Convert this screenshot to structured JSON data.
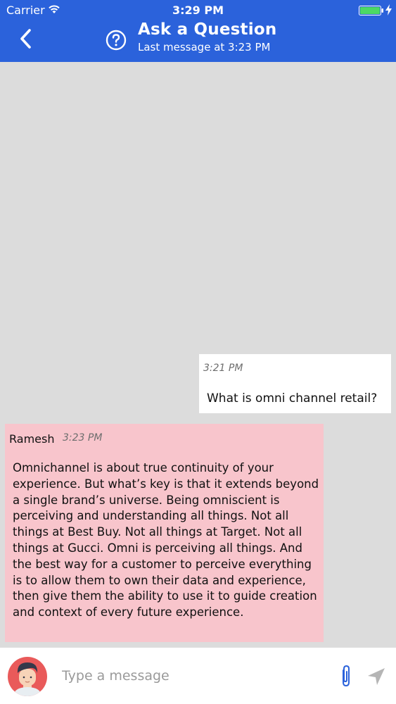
{
  "status_bar": {
    "carrier": "Carrier",
    "time": "3:29 PM"
  },
  "header": {
    "title": "Ask a Question",
    "subtitle": "Last message at 3:23 PM"
  },
  "messages": [
    {
      "time": "3:21 PM",
      "text": "What is omni channel retail?"
    },
    {
      "sender": "Ramesh",
      "time": "3:23 PM",
      "text": "Omnichannel is about true continuity of your experience. But what’s key is that it extends beyond a single brand’s universe. Being omniscient is perceiving and understanding all things.  Not all things at Best Buy. Not all things at Target. Not all things at Gucci. Omni is perceiving all things. And the best way for a customer to perceive everything is to allow them to own their data and experience, then give them the ability to use it to guide creation and context of every future experience."
    }
  ],
  "composer": {
    "placeholder": "Type a message"
  },
  "colors": {
    "header": "#2b62db",
    "chat_bg": "#dcdcdc",
    "incoming_bubble": "#f8c5cc",
    "outgoing_bubble": "#ffffff",
    "battery": "#4cd964"
  }
}
